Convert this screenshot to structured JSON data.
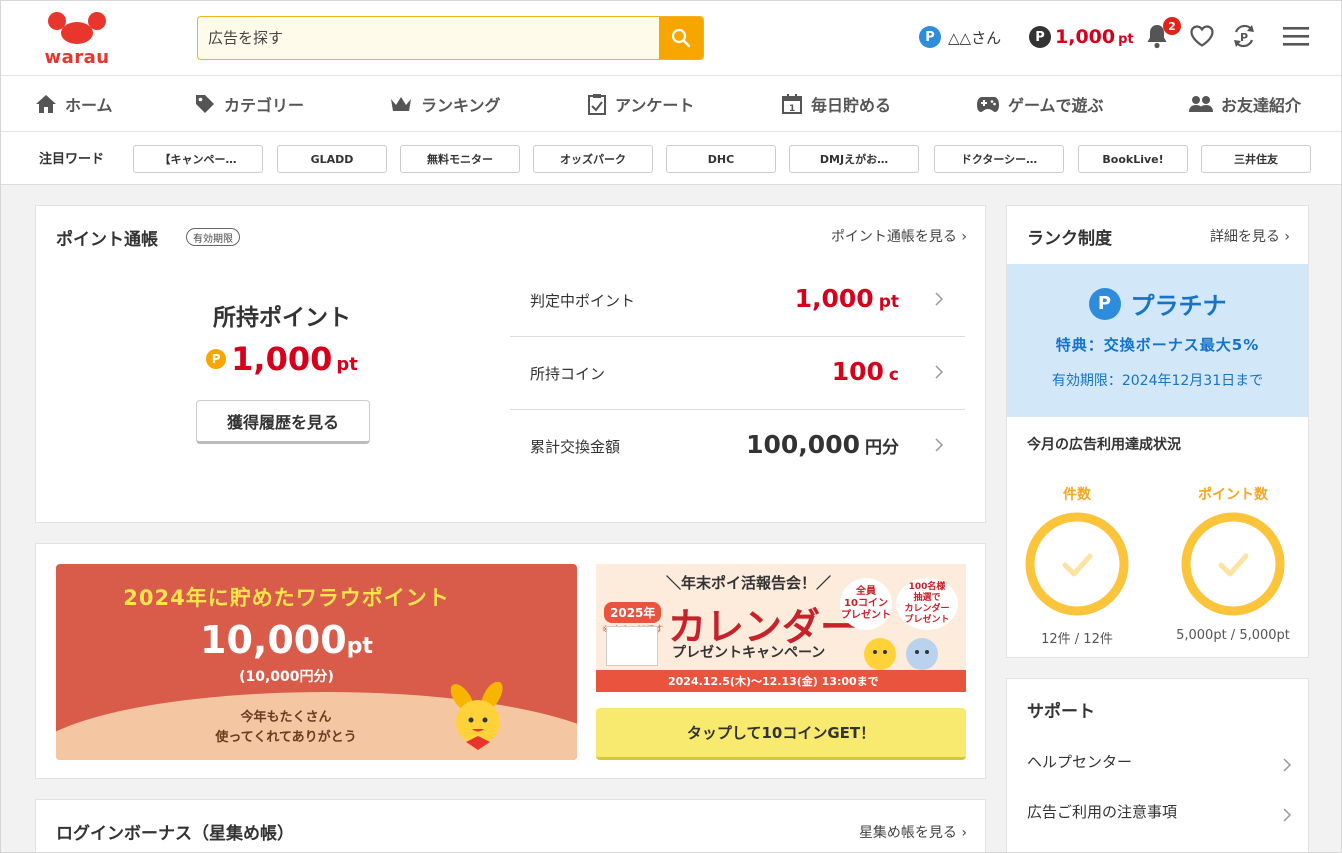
{
  "brand": {
    "logo_text": "warau",
    "primary_color": "#e8362d",
    "accent_color": "#f7a600"
  },
  "search": {
    "placeholder": "広告を探す",
    "icon": "search-icon"
  },
  "user": {
    "rank_badge": "P",
    "name": "△△さん",
    "points_badge": "P",
    "points": "1,000",
    "points_unit": "pt",
    "notification_count": "2"
  },
  "header_icons": [
    "bell-icon",
    "heart-icon",
    "point-exchange-icon",
    "hamburger-menu-icon"
  ],
  "nav": [
    {
      "label": "ホーム",
      "icon": "home-icon"
    },
    {
      "label": "カテゴリー",
      "icon": "tag-icon"
    },
    {
      "label": "ランキング",
      "icon": "crown-icon"
    },
    {
      "label": "アンケート",
      "icon": "survey-icon"
    },
    {
      "label": "毎日貯める",
      "icon": "calendar-icon"
    },
    {
      "label": "ゲームで遊ぶ",
      "icon": "gamepad-icon"
    },
    {
      "label": "お友達紹介",
      "icon": "friends-icon"
    }
  ],
  "keywords": {
    "label": "注目ワード",
    "items": [
      "【キャンペー…",
      "GLADD",
      "無料モニター",
      "オッズパーク",
      "DHC",
      "DMJえがお…",
      "ドクターシー…",
      "BookLive!",
      "三井住友"
    ]
  },
  "passbook": {
    "title": "ポイント通帳",
    "badge": "有効期限",
    "link": "ポイント通帳を見る",
    "owned_title": "所持ポイント",
    "owned_badge": "P",
    "owned_value": "1,000",
    "owned_unit": "pt",
    "history_button": "獲得履歴を見る",
    "rows": [
      {
        "label": "判定中ポイント",
        "value": "1,000",
        "unit": "pt",
        "color": "#d6001c"
      },
      {
        "label": "所持コイン",
        "value": "100",
        "unit": "c",
        "color": "#d6001c"
      },
      {
        "label": "累計交換金額",
        "value": "100,000",
        "unit": "円分",
        "color": "#333333"
      }
    ]
  },
  "banner_annual": {
    "headline": "2024年に貯めたワラウポイント",
    "value": "10,000",
    "unit": "pt",
    "sub": "(10,000円分)",
    "thanks_line1": "今年もたくさん",
    "thanks_line2": "使ってくれてありがとう"
  },
  "banner_calendar": {
    "top": "＼年末ポイ活報告会！／",
    "year_badge": "2025年",
    "note": "※イメージです",
    "title": "カレンダー",
    "subtitle": "プレゼントキャンペーン",
    "circle1_line1": "全員",
    "circle1_line2": "10コイン",
    "circle1_line3": "プレゼント",
    "circle2_line1": "抽選で",
    "circle2_line2": "カレンダー",
    "circle2_line3": "プレゼント",
    "circle2_badge": "100名様",
    "date": "2024.12.5(木)〜12.13(金) 13:00まで",
    "button": "タップして10コインGET！"
  },
  "login_bonus": {
    "title": "ログインボーナス（星集め帳）",
    "link": "星集め帳を見る"
  },
  "rank": {
    "title": "ランク制度",
    "link": "詳細を見る",
    "rank_badge": "P",
    "rank_name": "プラチナ",
    "perk": "特典：交換ボーナス最大5%",
    "expiry": "有効期限：2024年12月31日まで",
    "month_title": "今月の広告利用達成状況",
    "gauges": [
      {
        "label": "件数",
        "value": "12件 / 12件",
        "ratio": 1.0
      },
      {
        "label": "ポイント数",
        "value": "5,000pt / 5,000pt",
        "ratio": 1.0
      }
    ],
    "gauge_color": "#fbc43b"
  },
  "support": {
    "title": "サポート",
    "items": [
      "ヘルプセンター",
      "広告ご利用の注意事項"
    ]
  }
}
